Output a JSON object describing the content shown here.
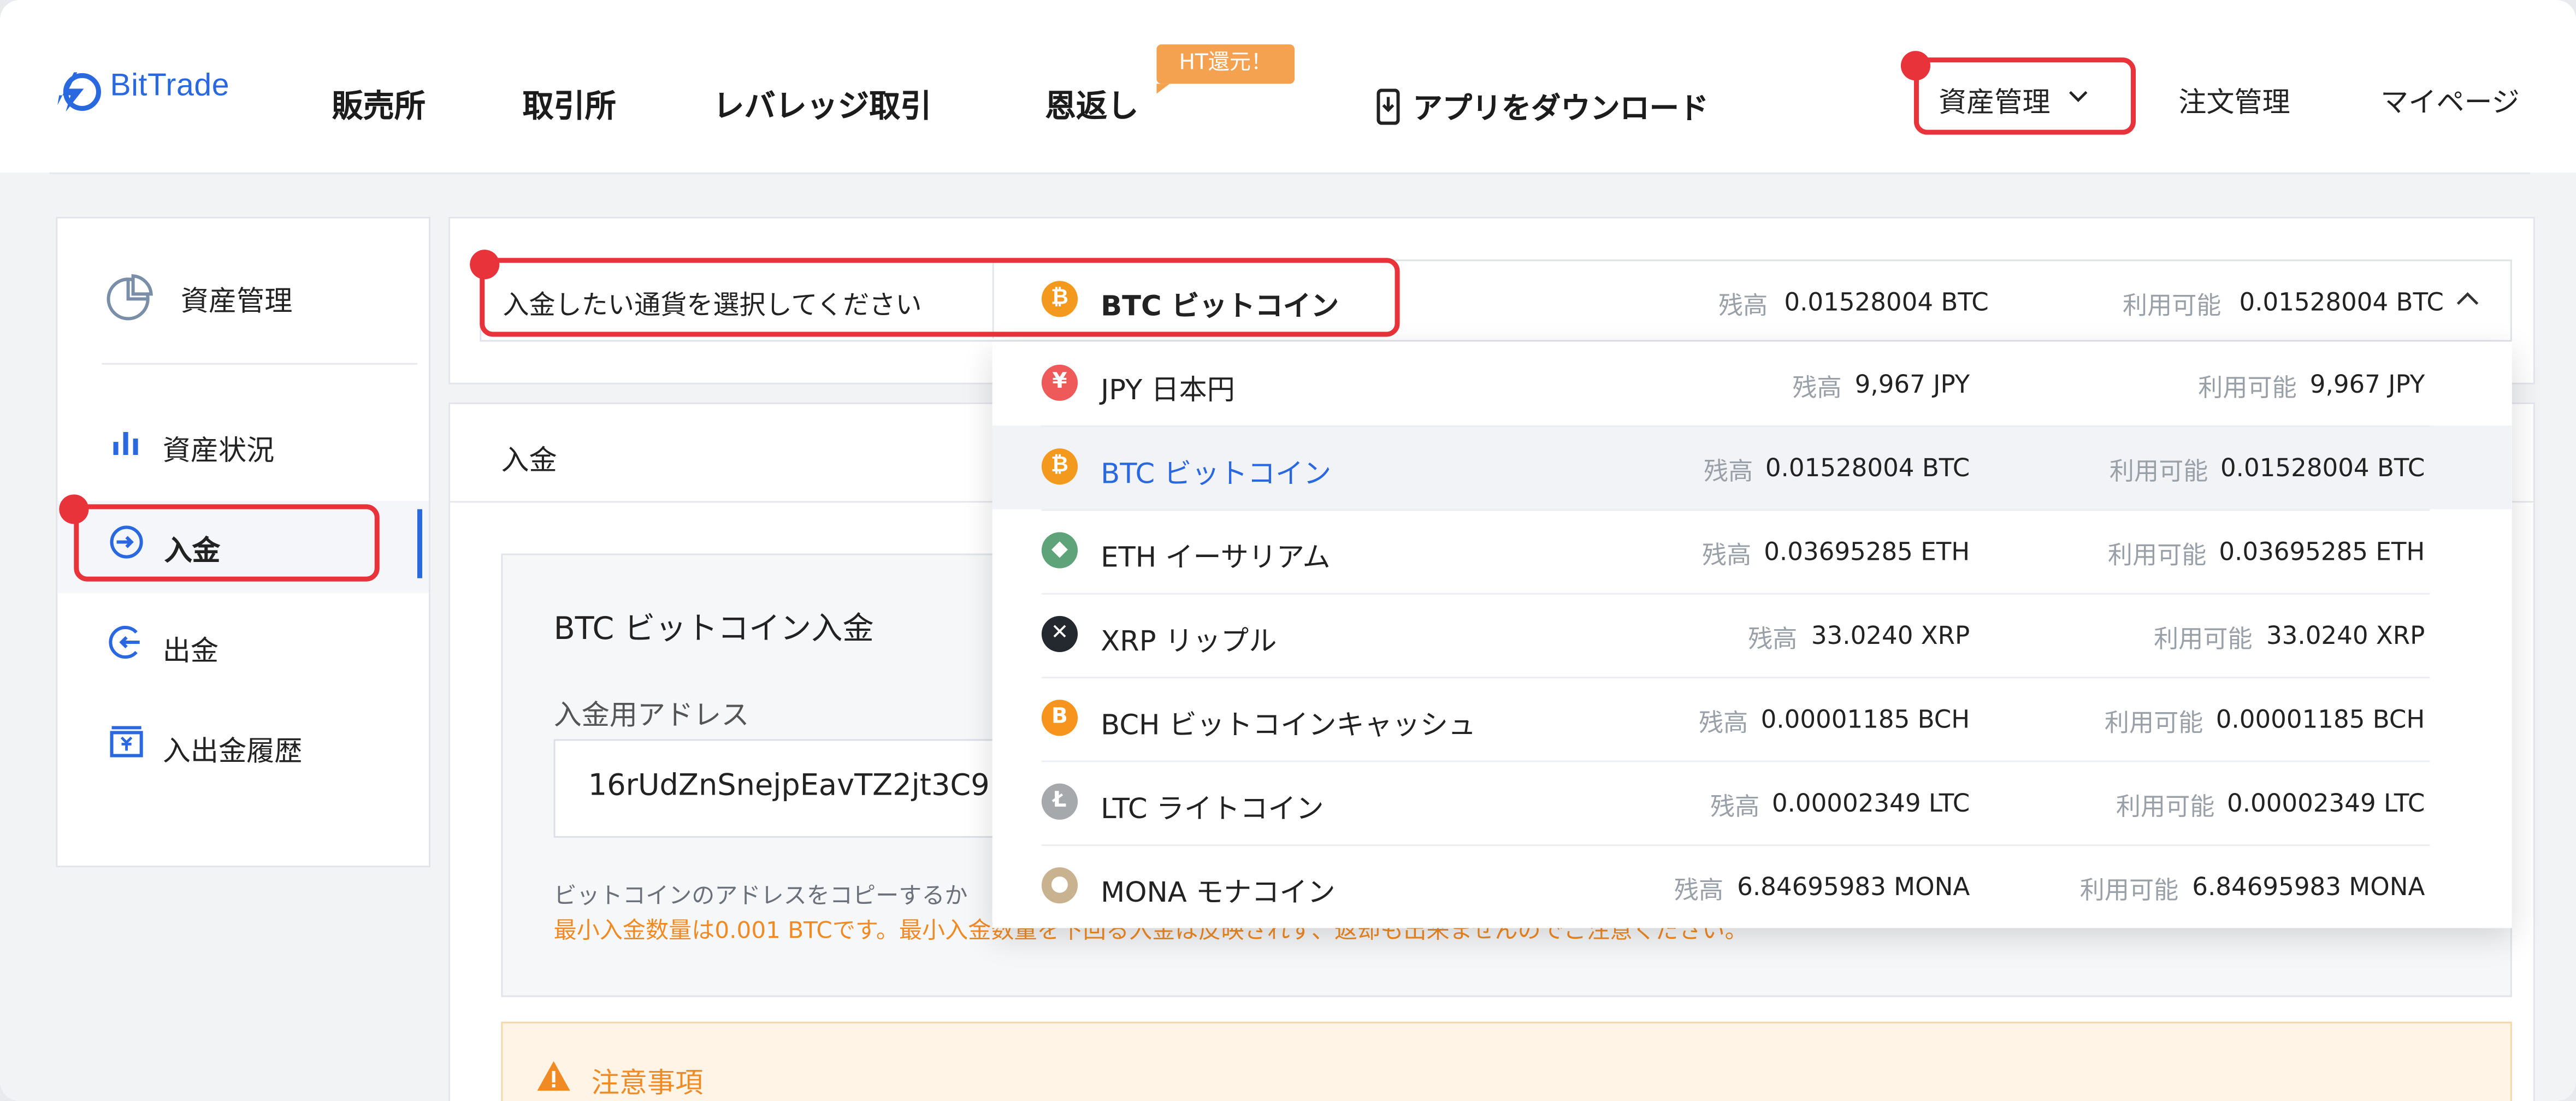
{
  "brand": {
    "name": "BitTrade",
    "accent": "#2a68e0",
    "highlight": "#e8333a"
  },
  "header": {
    "nav": [
      "販売所",
      "取引所",
      "レバレッジ取引",
      "恩返し"
    ],
    "badge": "HT還元！",
    "app_download": "アプリをダウンロード",
    "right": {
      "assets": "資産管理",
      "orders": "注文管理",
      "mypage": "マイページ"
    }
  },
  "sidebar": {
    "title": "資産管理",
    "items": [
      {
        "label": "資産状況",
        "icon": "bar-chart-icon"
      },
      {
        "label": "入金",
        "icon": "deposit-icon",
        "active": true
      },
      {
        "label": "出金",
        "icon": "withdraw-icon"
      },
      {
        "label": "入出金履歴",
        "icon": "history-icon"
      }
    ]
  },
  "selector": {
    "prompt": "入金したい通貨を選択してください",
    "selected_label": "BTC  ビットコイン",
    "balance_label": "残高",
    "balance_value": "0.01528004 BTC",
    "available_label": "利用可能",
    "available_value": "0.01528004 BTC"
  },
  "dropdown": {
    "balance_label": "残高",
    "available_label": "利用可能",
    "rows": [
      {
        "label": "JPY  日本円",
        "balance": "9,967 JPY",
        "available": "9,967 JPY",
        "icon": "yen-icon",
        "color": "#ee5a5a",
        "glyph": "¥"
      },
      {
        "label": "BTC  ビットコイン",
        "balance": "0.01528004 BTC",
        "available": "0.01528004 BTC",
        "icon": "bitcoin-icon",
        "color": "#f39a1e",
        "glyph": "₿",
        "selected": true
      },
      {
        "label": "ETH  イーサリアム",
        "balance": "0.03695285 ETH",
        "available": "0.03695285 ETH",
        "icon": "ethereum-icon",
        "color": "#5fa37a",
        "glyph": "◆"
      },
      {
        "label": "XRP  リップル",
        "balance": "33.0240 XRP",
        "available": "33.0240 XRP",
        "icon": "xrp-icon",
        "color": "#23292f",
        "glyph": "✕"
      },
      {
        "label": "BCH  ビットコインキャッシュ",
        "balance": "0.00001185 BCH",
        "available": "0.00001185 BCH",
        "icon": "bitcoin-cash-icon",
        "color": "#f7941d",
        "glyph": "B"
      },
      {
        "label": "LTC  ライトコイン",
        "balance": "0.00002349 LTC",
        "available": "0.00002349 LTC",
        "icon": "litecoin-icon",
        "color": "#a6a9ab",
        "glyph": "Ł"
      },
      {
        "label": "MONA  モナコイン",
        "balance": "6.84695983 MONA",
        "available": "6.84695983 MONA",
        "icon": "monacoin-icon",
        "color": "#c9b28f",
        "glyph": "●"
      }
    ]
  },
  "main": {
    "tab": "入金",
    "card_title": "BTC  ビットコイン入金",
    "address_label": "入金用アドレス",
    "address_value": "16rUdZnSnejpEavTZ2jt3C9",
    "note_line": "ビットコインのアドレスをコピーするか",
    "warning_line": "最小入金数量は0.001 BTCです。最小入金数量を下回る入金は反映されず、返却も出来ませんのでご注意ください。",
    "notice_title": "注意事項"
  }
}
